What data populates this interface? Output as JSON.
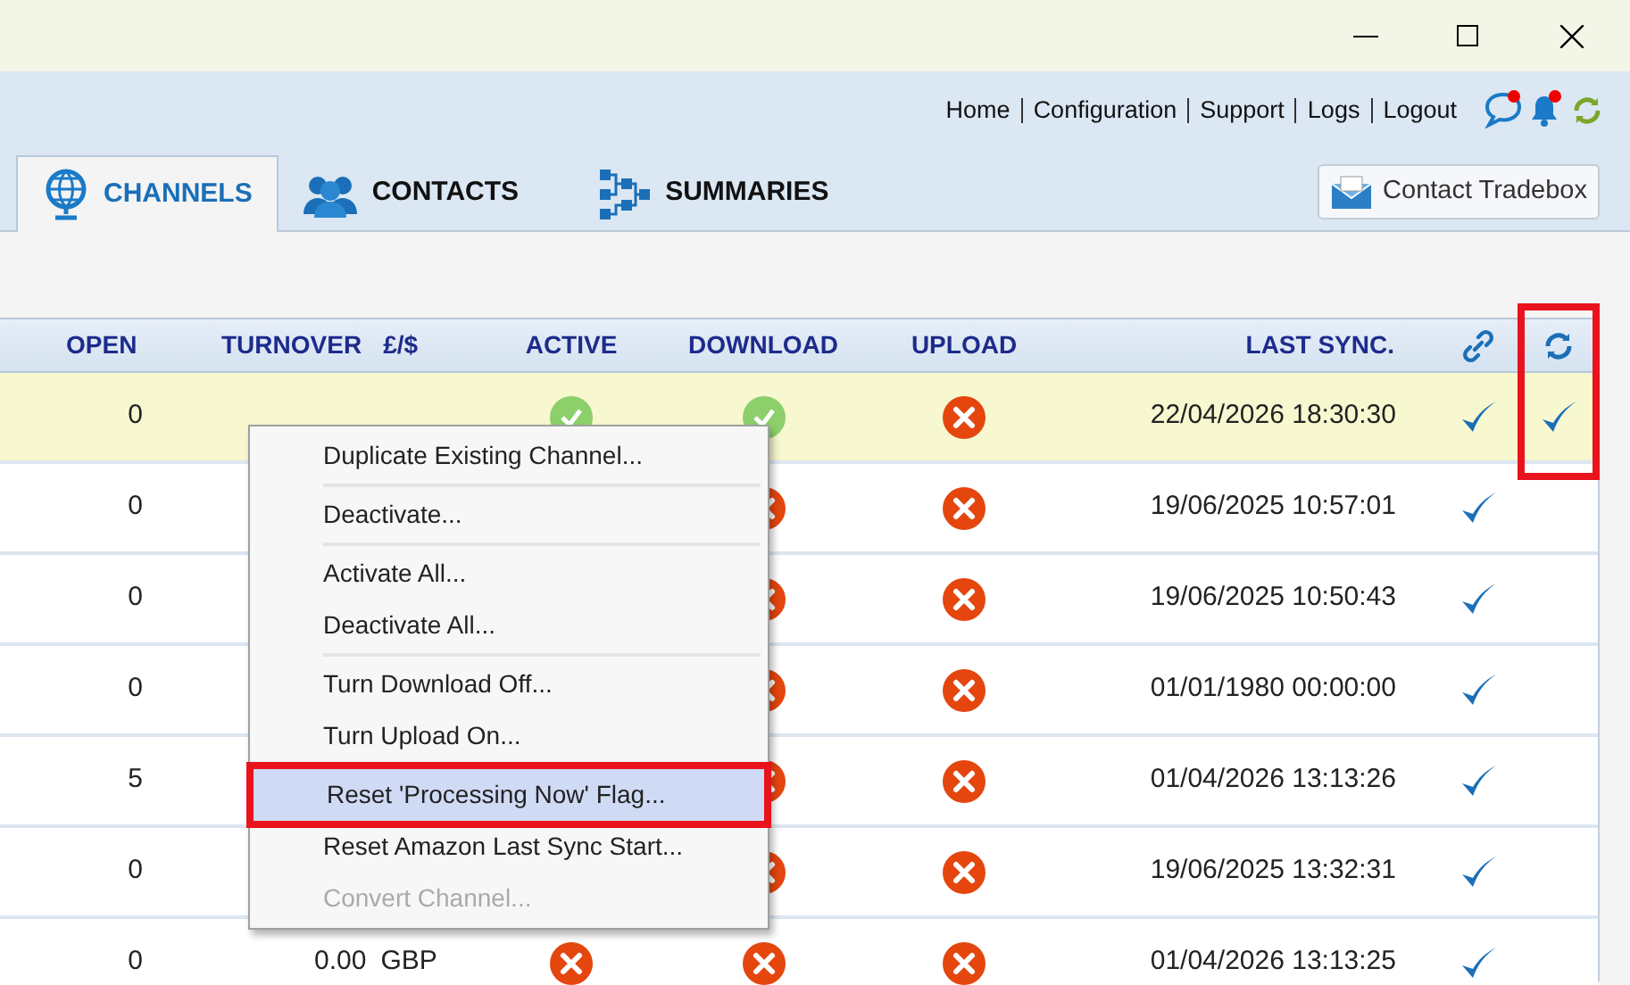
{
  "nav_links": [
    "Home",
    "Configuration",
    "Support",
    "Logs",
    "Logout"
  ],
  "tabs": [
    {
      "label": "CHANNELS",
      "selected": true
    },
    {
      "label": "CONTACTS",
      "selected": false
    },
    {
      "label": "SUMMARIES",
      "selected": false
    }
  ],
  "contact_button": "Contact Tradebox",
  "table": {
    "columns": [
      {
        "kind": "text",
        "label": "OPEN"
      },
      {
        "kind": "turnover",
        "label": "TURNOVER",
        "unit": "£/$"
      },
      {
        "kind": "text",
        "label": "ACTIVE"
      },
      {
        "kind": "text",
        "label": "DOWNLOAD"
      },
      {
        "kind": "text",
        "label": "UPLOAD"
      },
      {
        "kind": "text",
        "label": "LAST SYNC."
      },
      {
        "kind": "link"
      },
      {
        "kind": "sync",
        "highlighted": true
      }
    ],
    "rows": [
      {
        "selected": true,
        "open": "0",
        "active": true,
        "download": true,
        "upload": false,
        "last_sync": "22/04/2026 18:30:30",
        "linked": true,
        "syncing": true
      },
      {
        "selected": false,
        "open": "0",
        "download": false,
        "upload": false,
        "last_sync": "19/06/2025 10:57:01",
        "linked": true,
        "syncing": false
      },
      {
        "selected": false,
        "open": "0",
        "download": false,
        "upload": false,
        "last_sync": "19/06/2025 10:50:43",
        "linked": true,
        "syncing": false
      },
      {
        "selected": false,
        "open": "0",
        "download": false,
        "upload": false,
        "last_sync": "01/01/1980 00:00:00",
        "linked": true,
        "syncing": false
      },
      {
        "selected": false,
        "open": "5",
        "download": false,
        "upload": false,
        "last_sync": "01/04/2026 13:13:26",
        "linked": true,
        "syncing": false
      },
      {
        "selected": false,
        "open": "0",
        "download": false,
        "upload": false,
        "last_sync": "19/06/2025 13:32:31",
        "linked": true,
        "syncing": false
      },
      {
        "selected": false,
        "open": "0",
        "turnover": "0.00",
        "currency": "GBP",
        "active": false,
        "download": false,
        "upload": false,
        "last_sync": "01/04/2026 13:13:25",
        "linked": true,
        "syncing": false
      }
    ]
  },
  "context_menu": [
    {
      "label": "Duplicate Existing Channel...",
      "disabled": false,
      "selected": false,
      "separator_after": true
    },
    {
      "label": "Deactivate...",
      "disabled": false,
      "selected": false,
      "separator_after": true
    },
    {
      "label": "Activate All...",
      "disabled": false,
      "selected": false,
      "separator_after": false
    },
    {
      "label": "Deactivate All...",
      "disabled": false,
      "selected": false,
      "separator_after": true
    },
    {
      "label": "Turn Download Off...",
      "disabled": false,
      "selected": false,
      "separator_after": false
    },
    {
      "label": "Turn Upload On...",
      "disabled": false,
      "selected": false,
      "separator_after": true
    },
    {
      "label": "Reset 'Processing Now' Flag...",
      "disabled": false,
      "selected": true,
      "separator_after": false
    },
    {
      "label": "Reset Amazon Last Sync Start...",
      "disabled": false,
      "selected": false,
      "separator_after": false
    },
    {
      "label": "Convert Channel...",
      "disabled": true,
      "selected": false,
      "separator_after": false
    }
  ]
}
